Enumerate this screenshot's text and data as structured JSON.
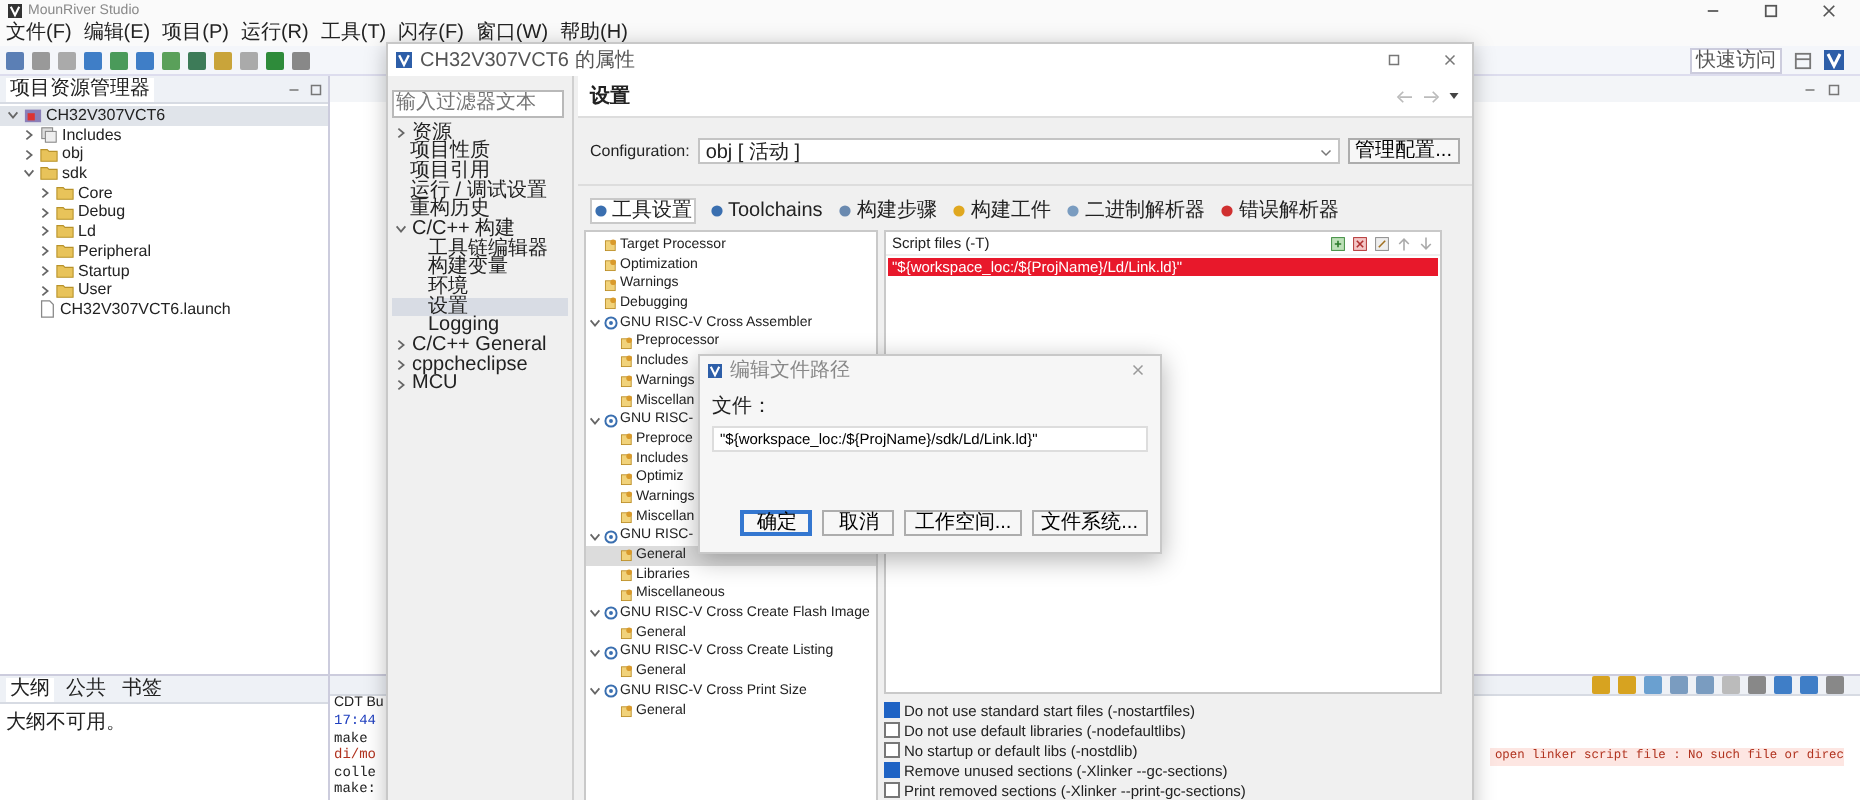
{
  "window": {
    "title": "MounRiver Studio"
  },
  "menu": [
    "文件(F)",
    "编辑(E)",
    "项目(P)",
    "运行(R)",
    "工具(T)",
    "闪存(F)",
    "窗口(W)",
    "帮助(H)"
  ],
  "quick_access": "快速访问",
  "explorer": {
    "tab": "项目资源管理器",
    "tree": [
      {
        "label": "CH32V307VCT6",
        "kind": "project",
        "expanded": true,
        "selected": true,
        "children": [
          {
            "label": "Includes",
            "kind": "includes",
            "expanded": false
          },
          {
            "label": "obj",
            "kind": "folder",
            "expanded": false
          },
          {
            "label": "sdk",
            "kind": "folder",
            "expanded": true,
            "children": [
              {
                "label": "Core",
                "kind": "folder",
                "expanded": false
              },
              {
                "label": "Debug",
                "kind": "folder",
                "expanded": false
              },
              {
                "label": "Ld",
                "kind": "folder",
                "expanded": false
              },
              {
                "label": "Peripheral",
                "kind": "folder",
                "expanded": false
              },
              {
                "label": "Startup",
                "kind": "folder",
                "expanded": false
              },
              {
                "label": "User",
                "kind": "folder",
                "expanded": false
              }
            ]
          },
          {
            "label": "CH32V307VCT6.launch",
            "kind": "file"
          }
        ]
      }
    ]
  },
  "outline": {
    "tabs": [
      {
        "label": "大纲",
        "selected": true
      },
      {
        "label": "公共",
        "selected": false
      },
      {
        "label": "书签",
        "selected": false
      }
    ],
    "message": "大纲不可用。"
  },
  "console": {
    "rows": [
      {
        "kind": "title",
        "left": "CDT Bu"
      },
      {
        "kind": "time",
        "left": "17:44"
      },
      {
        "kind": "plain",
        "left": "make"
      },
      {
        "kind": "error",
        "left": "di/mo",
        "right": "open linker script file : No such file or direc"
      },
      {
        "kind": "plain",
        "left": "colle"
      },
      {
        "kind": "plain",
        "left": "make:"
      }
    ]
  },
  "properties": {
    "title": "CH32V307VCT6 的属性",
    "filter": {
      "placeholder": "输入过滤器文本"
    },
    "nav": [
      {
        "label": "资源",
        "expanded": false
      },
      {
        "label": "项目性质"
      },
      {
        "label": "项目引用"
      },
      {
        "label": "运行 / 调试设置"
      },
      {
        "label": "重构历史"
      },
      {
        "label": "C/C++ 构建",
        "expanded": true,
        "children": [
          {
            "label": "工具链编辑器",
            "selected": false
          },
          {
            "label": "构建变量",
            "selected": false
          },
          {
            "label": "环境",
            "selected": false
          },
          {
            "label": "设置",
            "selected": true
          },
          {
            "label": "Logging",
            "selected": false
          }
        ]
      },
      {
        "label": "C/C++ General",
        "expanded": false
      },
      {
        "label": "cppcheclipse",
        "expanded": false
      },
      {
        "label": "MCU",
        "expanded": false
      }
    ],
    "heading": "设置",
    "configuration": {
      "label": "Configuration:",
      "value": "obj  [ 活动 ]"
    },
    "manage_button": "管理配置...",
    "tabs": [
      {
        "label": "工具设置",
        "selected": true
      },
      {
        "label": "Toolchains",
        "selected": false
      },
      {
        "label": "构建步骤",
        "selected": false
      },
      {
        "label": "构建工件",
        "selected": false
      },
      {
        "label": "二进制解析器",
        "selected": false
      },
      {
        "label": "错误解析器",
        "selected": false
      }
    ],
    "tool_tree": [
      {
        "label": "Target Processor",
        "kind": "option",
        "selected": false
      },
      {
        "label": "Optimization",
        "kind": "option",
        "selected": false
      },
      {
        "label": "Warnings",
        "kind": "option",
        "selected": false
      },
      {
        "label": "Debugging",
        "kind": "option",
        "selected": false
      },
      {
        "label": "GNU RISC-V Cross Assembler",
        "kind": "tool",
        "expanded": true,
        "children": [
          {
            "label": "Preprocessor",
            "kind": "option",
            "selected": false
          },
          {
            "label": "Includes",
            "kind": "option",
            "selected": false
          },
          {
            "label": "Warnings",
            "kind": "option",
            "selected": false
          },
          {
            "label": "Miscellan",
            "kind": "option",
            "selected": false
          }
        ]
      },
      {
        "label": "GNU RISC-",
        "kind": "tool",
        "expanded": true,
        "children": [
          {
            "label": "Preproce",
            "kind": "option",
            "selected": false
          },
          {
            "label": "Includes",
            "kind": "option",
            "selected": false
          },
          {
            "label": "Optimiz",
            "kind": "option",
            "selected": false
          },
          {
            "label": "Warnings",
            "kind": "option",
            "selected": false
          },
          {
            "label": "Miscellan",
            "kind": "option",
            "selected": false
          }
        ]
      },
      {
        "label": "GNU RISC-",
        "kind": "tool",
        "expanded": true,
        "children": [
          {
            "label": "General",
            "kind": "option",
            "selected": true
          },
          {
            "label": "Libraries",
            "kind": "option",
            "selected": false
          },
          {
            "label": "Miscellaneous",
            "kind": "option",
            "selected": false
          }
        ]
      },
      {
        "label": "GNU RISC-V Cross Create Flash Image",
        "kind": "tool",
        "expanded": true,
        "children": [
          {
            "label": "General",
            "kind": "option",
            "selected": false
          }
        ]
      },
      {
        "label": "GNU RISC-V Cross Create Listing",
        "kind": "tool",
        "expanded": true,
        "children": [
          {
            "label": "General",
            "kind": "option",
            "selected": false
          }
        ]
      },
      {
        "label": "GNU RISC-V Cross Print Size",
        "kind": "tool",
        "expanded": true,
        "children": [
          {
            "label": "General",
            "kind": "option",
            "selected": false
          }
        ]
      }
    ],
    "script_files": {
      "header": "Script files (-T)",
      "rows": [
        {
          "text": "\"${workspace_loc:/${ProjName}/Ld/Link.ld}\"",
          "selected": true
        }
      ]
    },
    "options": [
      {
        "label": "Do not use standard start files (-nostartfiles)",
        "checked": true
      },
      {
        "label": "Do not use default libraries (-nodefaultlibs)",
        "checked": false
      },
      {
        "label": "No startup or default libs (-nostdlib)",
        "checked": false
      },
      {
        "label": "Remove unused sections (-Xlinker --gc-sections)",
        "checked": true
      },
      {
        "label": "Print removed sections (-Xlinker --print-gc-sections)",
        "checked": false
      }
    ]
  },
  "edit_dialog": {
    "title": "编辑文件路径",
    "label": "文件：",
    "value": "\"${workspace_loc:/${ProjName}/sdk/Ld/Link.ld}\"",
    "buttons": [
      {
        "label": "确定",
        "default": true
      },
      {
        "label": "取消",
        "default": false
      },
      {
        "label": "工作空间...",
        "default": false
      },
      {
        "label": "文件系统...",
        "default": false
      }
    ]
  }
}
